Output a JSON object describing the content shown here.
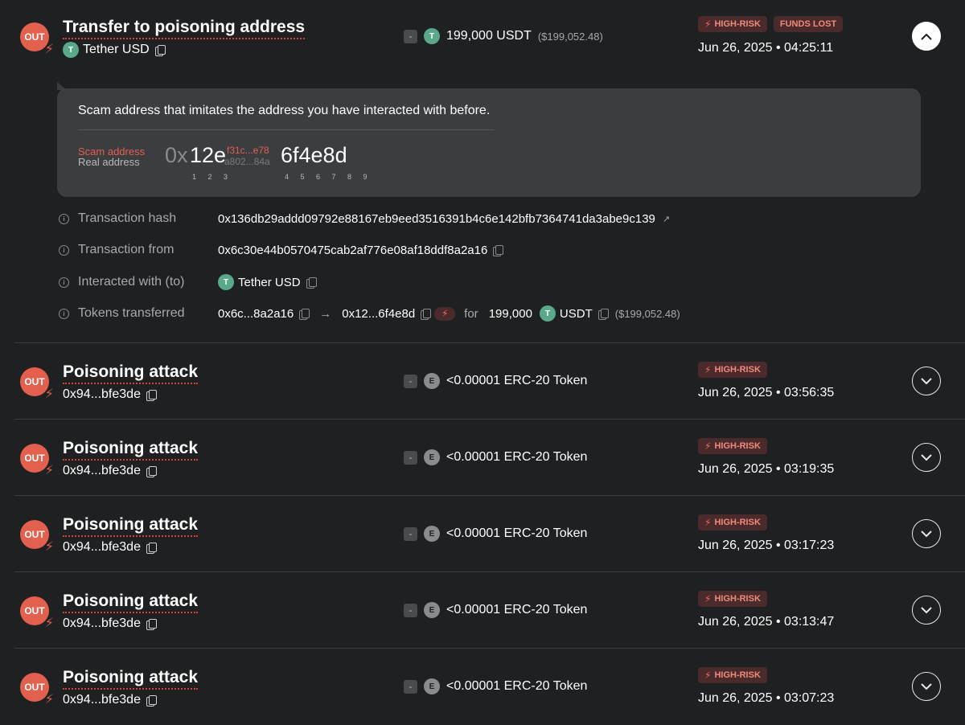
{
  "first_tx": {
    "direction": "OUT",
    "title": "Transfer to poisoning address",
    "token_symbol_letter": "T",
    "token_name": "Tether USD",
    "amount_sign": "-",
    "amount": "199,000 USDT",
    "amount_usd": "($199,052.48)",
    "tags": [
      "HIGH-RISK",
      "FUNDS LOST"
    ],
    "date": "Jun 26, 2025 • 04:25:11",
    "expanded": true
  },
  "scam_box": {
    "description": "Scam address that imitates the address you have interacted with before.",
    "scam_label": "Scam address",
    "real_label": "Real address",
    "prefix": "0x",
    "match_start": "12e",
    "scam_middle": "f31c...e78",
    "real_middle": "a802...84a",
    "match_end": "6f4e8d",
    "start_positions": "1 2 3",
    "end_positions": "4 5 6 7 8 9"
  },
  "details": {
    "hash_label": "Transaction hash",
    "hash_value": "0x136db29addd09792e88167eb9eed3516391b4c6e142bfb7364741da3abe9c139",
    "from_label": "Transaction from",
    "from_value": "0x6c30e44b0570475cab2af776e08af18ddf8a2a16",
    "with_label": "Interacted with (to)",
    "with_value": "Tether USD",
    "tokens_label": "Tokens transferred",
    "tokens_from": "0x6c...8a2a16",
    "tokens_to": "0x12...6f4e8d",
    "tokens_for": "for",
    "tokens_amount": "199,000",
    "tokens_symbol": "USDT",
    "tokens_usd": "($199,052.48)"
  },
  "attacks": [
    {
      "direction": "OUT",
      "title": "Poisoning attack",
      "address": "0x94...bfe3de",
      "amount_sign": "-",
      "token_letter": "E",
      "amount": "<0.00001 ERC-20 Token",
      "tag": "HIGH-RISK",
      "date": "Jun 26, 2025 • 03:56:35"
    },
    {
      "direction": "OUT",
      "title": "Poisoning attack",
      "address": "0x94...bfe3de",
      "amount_sign": "-",
      "token_letter": "E",
      "amount": "<0.00001 ERC-20 Token",
      "tag": "HIGH-RISK",
      "date": "Jun 26, 2025 • 03:19:35"
    },
    {
      "direction": "OUT",
      "title": "Poisoning attack",
      "address": "0x94...bfe3de",
      "amount_sign": "-",
      "token_letter": "E",
      "amount": "<0.00001 ERC-20 Token",
      "tag": "HIGH-RISK",
      "date": "Jun 26, 2025 • 03:17:23"
    },
    {
      "direction": "OUT",
      "title": "Poisoning attack",
      "address": "0x94...bfe3de",
      "amount_sign": "-",
      "token_letter": "E",
      "amount": "<0.00001 ERC-20 Token",
      "tag": "HIGH-RISK",
      "date": "Jun 26, 2025 • 03:13:47"
    },
    {
      "direction": "OUT",
      "title": "Poisoning attack",
      "address": "0x94...bfe3de",
      "amount_sign": "-",
      "token_letter": "E",
      "amount": "<0.00001 ERC-20 Token",
      "tag": "HIGH-RISK",
      "date": "Jun 26, 2025 • 03:07:23"
    }
  ],
  "colors": {
    "background": "#1f2022",
    "out_badge": "#e2604d",
    "risk_tag_bg": "#4a2a2a",
    "risk_tag_text": "#f08a7c",
    "tether": "#5aa88a"
  }
}
